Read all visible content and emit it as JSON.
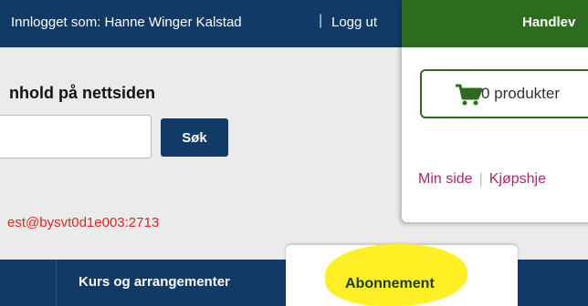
{
  "header": {
    "logged_in_text": "Innlogget som: Hanne Winger Kalstad",
    "separator": "|",
    "logout_label": "Logg ut"
  },
  "search": {
    "label": "nhold på nettsiden",
    "input_value": "",
    "button_label": "Søk"
  },
  "debug_text": "est@bysvt0d1e003:2713",
  "cart": {
    "header_title": "Handlev",
    "icon": "cart-icon",
    "count_text": "0  produkter",
    "links": [
      "Min side",
      "Kjøpshje"
    ],
    "link_separator": "|",
    "accent_color": "#2d6b1f",
    "link_color": "#b0236c"
  },
  "nav": {
    "items": [
      "Kurs og arrangementer"
    ],
    "active_tab": "Abonnement",
    "background_color": "#123a66",
    "highlight_color": "#ffef1a"
  }
}
